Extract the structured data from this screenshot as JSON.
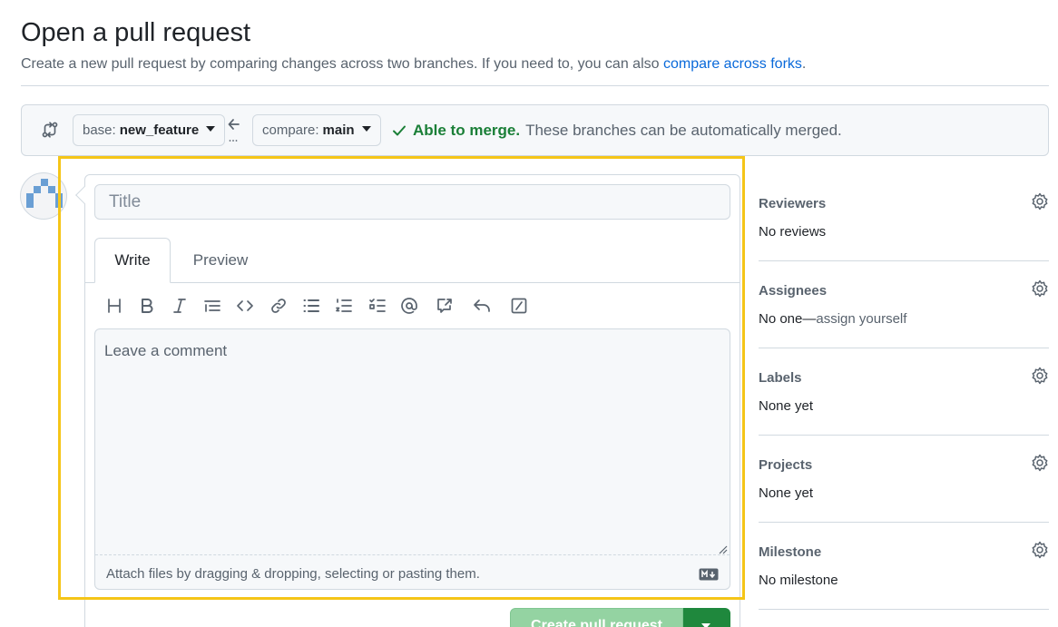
{
  "header": {
    "title": "Open a pull request",
    "subtitle_prefix": "Create a new pull request by comparing changes across two branches. If you need to, you can also ",
    "subtitle_link": "compare across forks",
    "subtitle_suffix": "."
  },
  "compare": {
    "base_prefix": "base:",
    "base_value": "new_feature",
    "compare_prefix": "compare:",
    "compare_value": "main",
    "merge_ok": "Able to merge.",
    "merge_text": "These branches can be automatically merged."
  },
  "form": {
    "title_placeholder": "Title",
    "tabs": [
      {
        "label": "Write"
      },
      {
        "label": "Preview"
      }
    ],
    "toolbar_icons": [
      "heading-icon",
      "bold-icon",
      "italic-icon",
      "quote-icon",
      "code-icon",
      "link-icon",
      "unordered-list-icon",
      "ordered-list-icon",
      "task-list-icon",
      "mention-icon",
      "reference-icon",
      "reply-icon",
      "slash-command-icon"
    ],
    "comment_placeholder": "Leave a comment",
    "attach_text": "Attach files by dragging & dropping, selecting or pasting them.",
    "submit_label": "Create pull request"
  },
  "sidebar": {
    "items": [
      {
        "label": "Reviewers",
        "value": "No reviews"
      },
      {
        "label": "Assignees",
        "value": "No one—",
        "value_muted": "assign yourself"
      },
      {
        "label": "Labels",
        "value": "None yet"
      },
      {
        "label": "Projects",
        "value": "None yet"
      },
      {
        "label": "Milestone",
        "value": "No milestone"
      }
    ]
  },
  "colors": {
    "accent_link": "#0969da",
    "success": "#1a7f37",
    "highlight": "#f5c518",
    "button_green": "#1f883d"
  }
}
